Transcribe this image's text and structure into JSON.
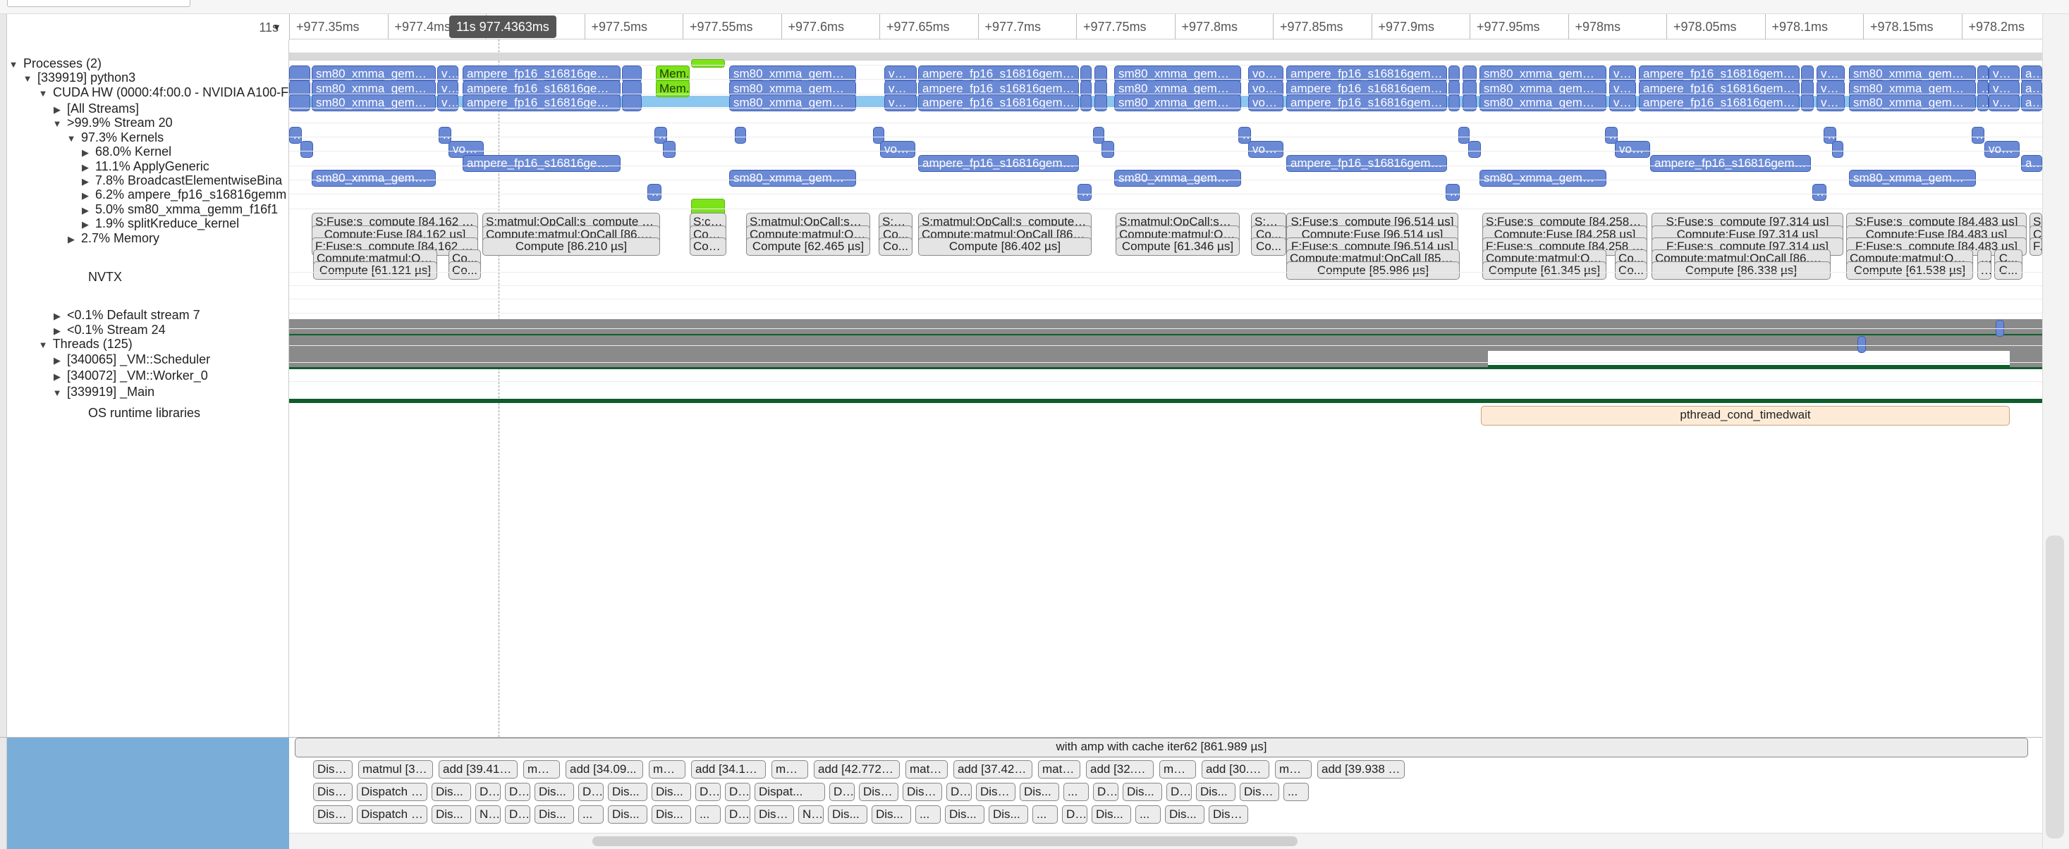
{
  "timeline": {
    "zoom_label": "11s",
    "cursor_label": "11s 977.4363ms",
    "ticks": [
      "+977.35ms",
      "+977.4ms",
      "+977.45ms",
      "+977.5ms",
      "+977.55ms",
      "+977.6ms",
      "+977.65ms",
      "+977.7ms",
      "+977.75ms",
      "+977.8ms",
      "+977.85ms",
      "+977.9ms",
      "+977.95ms",
      "+978ms",
      "+978.05ms",
      "+978.1ms",
      "+978.15ms",
      "+978.2ms"
    ]
  },
  "tree": {
    "processes": "Processes (2)",
    "python": "[339919] python3",
    "cuda": "CUDA HW (0000:4f:00.0 - NVIDIA A100-F",
    "all_streams": "[All Streams]",
    "stream20": ">99.9% Stream 20",
    "kernels": "97.3% Kernels",
    "k_kernel": "68.0% Kernel",
    "k_apply": "11.1% ApplyGeneric",
    "k_broadcast": "7.8% BroadcastElementwiseBina",
    "k_ampere": "6.2% ampere_fp16_s16816gemm",
    "k_sm80": "5.0% sm80_xmma_gemm_f16f1",
    "k_split": "1.9% splitKreduce_kernel",
    "memory": "2.7% Memory",
    "nvtx": "NVTX",
    "default7": "<0.1% Default stream 7",
    "stream24": "<0.1% Stream 24",
    "threads": "Threads (125)",
    "scheduler": "[340065] _VM::Scheduler",
    "worker": "[340072] _VM::Worker_0",
    "main": "[339919] _Main",
    "osrt": "OS runtime libraries"
  },
  "kernels": {
    "sm80": "sm80_xmma_gemm_...",
    "sm80b": "sm80_xmma_gemm_f...",
    "ampere": "ampere_fp16_s16816gemm_...",
    "ampere2": "ampere_fp16_s16816gemm...",
    "ampereb": "ampere_fp16_s16816gemm_f...",
    "voi": "voi...",
    "void": "void...",
    "vo": "vo...",
    "mem": "Mem...",
    "dots": "...",
    "a": "a..."
  },
  "nvtx": {
    "r1": [
      "S:Fuse:s_compute [84.162 µs]",
      "S:matmul:OpCall:s_compute [8...",
      "S:co...",
      "S:matmul:OpCall:s_co...",
      "S:br...",
      "S:matmul:OpCall:s_compute [86...",
      "S:matmul:OpCall:s_co...",
      "S:br...",
      "S:Fuse:s_compute [96.514 µs]",
      "S:Fuse:s_compute [84.258 µs]",
      "S:Fuse:s_compute [97.314 µs]",
      "S:Fuse:s_compute [84.483 µs]",
      "S..."
    ],
    "r2": [
      "Compute:Fuse [84.162 µs]",
      "Compute:matmul:OpCall [86.21...",
      "Com...",
      "Compute:matmul:OpC...",
      "Co...",
      "Compute:matmul:OpCall [86.40...",
      "Compute:matmul:Op...",
      "Co...",
      "Compute:Fuse [96.514 µs]",
      "Compute:Fuse [84.258 µs]",
      "Compute:Fuse [97.314 µs]",
      "Compute:Fuse [84.483 µs]",
      "C..."
    ],
    "r3": [
      "F:Fuse:s_compute [84.162 µs]",
      "Compute [86.210 µs]",
      "Com...",
      "Compute [62.465 µs]",
      "Co...",
      "Compute [86.402 µs]",
      "Compute [61.346 µs]",
      "Co...",
      "F:Fuse:s_compute [96.514 µs]",
      "F:Fuse:s_compute [84.258 µs]",
      "F:Fuse:s_compute [97.314 µs]",
      "F:Fuse:s_compute [84.483 µs]",
      "F..."
    ],
    "r4": [
      "Compute:matmul:Op...",
      "Co...",
      "Compute:matmul:OpCall [85.98...",
      "Compute:matmul:Op...",
      "Co...",
      "Compute:matmul:OpCall [86.33...",
      "Compute:matmul:Op...",
      "...",
      "C..."
    ],
    "r5": [
      "Compute [61.121 µs]",
      "Co...",
      "Compute [85.986 µs]",
      "Compute [61.345 µs]",
      "Co...",
      "Compute [86.338 µs]",
      "Compute [61.538 µs]",
      "...",
      "C..."
    ]
  },
  "osrt": {
    "wait": "pthread_cond_timedwait"
  },
  "bottom": {
    "main": "with amp with cache iter62 [861.989 µs]",
    "b1": [
      "Dispa...",
      "matmul [36....",
      "add [39.415 ...",
      "mat...",
      "add [34.09...",
      "mat...",
      "add [34.12...",
      "mat...",
      "add [42.772 µs]",
      "matm...",
      "add [37.421 ...",
      "matm...",
      "add [32.3...",
      "mat...",
      "add [30.9...",
      "mat...",
      "add [39.938 µs]"
    ],
    "b2": [
      "Disp...",
      "Dispatch [...",
      "Dis...",
      "Di...",
      "Di...",
      "Dis...",
      "D...",
      "Dis...",
      "Dis...",
      "D...",
      "Di...",
      "Dispat...",
      "Di...",
      "Disp...",
      "Disp...",
      "Di...",
      "Disp...",
      "Dis...",
      "...",
      "Di...",
      "Dis...",
      "Di...",
      "Dis...",
      "Dispa...",
      "..."
    ],
    "b3": [
      "Disp...",
      "Dispatch [...",
      "Dis...",
      "N...",
      "Di...",
      "Dis...",
      "...",
      "Dis...",
      "Dis...",
      "...",
      "Di...",
      "Dispa...",
      "N...",
      "Dis...",
      "Dis...",
      "...",
      "Dis...",
      "Dis...",
      "...",
      "Di...",
      "Dis...",
      "...",
      "Dis...",
      "Dispa..."
    ]
  },
  "colors": {
    "kernel": "#6b8ad6",
    "memory": "#7de21a",
    "band": "#8cc7ef",
    "nvtx": "#e4e4e4"
  }
}
